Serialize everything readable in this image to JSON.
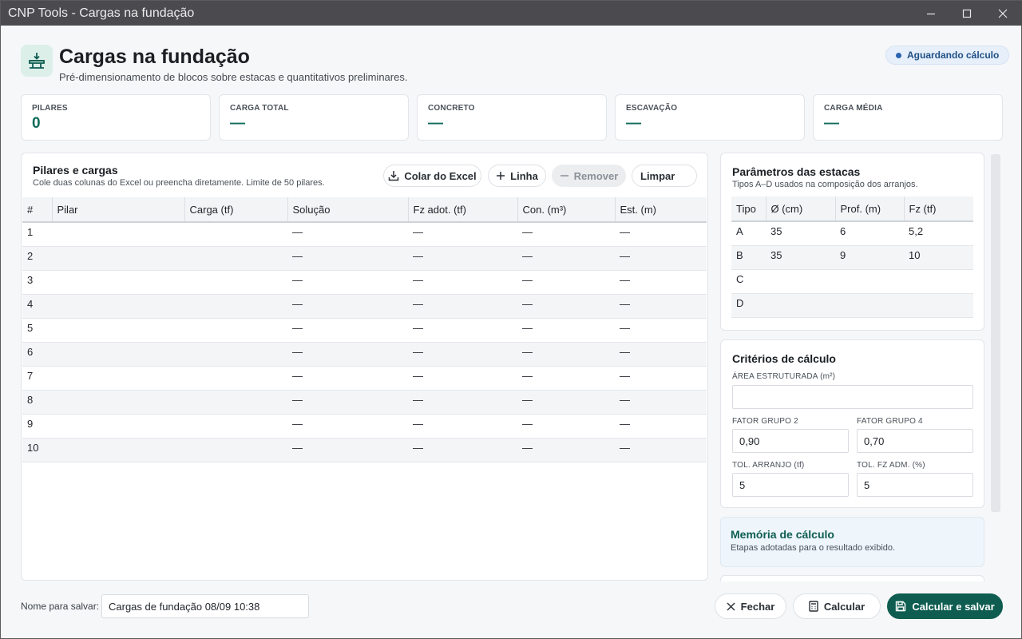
{
  "window": {
    "title": "CNP Tools - Cargas na fundação"
  },
  "header": {
    "title": "Cargas na fundação",
    "subtitle": "Pré-dimensionamento de blocos sobre estacas e quantitativos preliminares.",
    "status": "Aguardando cálculo"
  },
  "stats": [
    {
      "label": "PILARES",
      "value": "0"
    },
    {
      "label": "CARGA TOTAL",
      "value": "—"
    },
    {
      "label": "CONCRETO",
      "value": "—"
    },
    {
      "label": "ESCAVAÇÃO",
      "value": "—"
    },
    {
      "label": "CARGA MÉDIA",
      "value": "—"
    }
  ],
  "pillars": {
    "title": "Pilares e cargas",
    "subtitle": "Cole duas colunas do Excel ou preencha diretamente. Limite de 50 pilares.",
    "buttons": {
      "paste": "Colar do Excel",
      "add_row": "Linha",
      "remove": "Remover",
      "clear": "Limpar"
    },
    "columns": [
      "#",
      "Pilar",
      "Carga (tf)",
      "Solução",
      "Fz adot. (tf)",
      "Con. (m³)",
      "Est. (m)"
    ],
    "rows": [
      [
        "1",
        "",
        "",
        "—",
        "—",
        "—",
        "—"
      ],
      [
        "2",
        "",
        "",
        "—",
        "—",
        "—",
        "—"
      ],
      [
        "3",
        "",
        "",
        "—",
        "—",
        "—",
        "—"
      ],
      [
        "4",
        "",
        "",
        "—",
        "—",
        "—",
        "—"
      ],
      [
        "5",
        "",
        "",
        "—",
        "—",
        "—",
        "—"
      ],
      [
        "6",
        "",
        "",
        "—",
        "—",
        "—",
        "—"
      ],
      [
        "7",
        "",
        "",
        "—",
        "—",
        "—",
        "—"
      ],
      [
        "8",
        "",
        "",
        "—",
        "—",
        "—",
        "—"
      ],
      [
        "9",
        "",
        "",
        "—",
        "—",
        "—",
        "—"
      ],
      [
        "10",
        "",
        "",
        "—",
        "—",
        "—",
        "—"
      ]
    ]
  },
  "stakes": {
    "title": "Parâmetros das estacas",
    "subtitle": "Tipos A–D usados na composição dos arranjos.",
    "columns": [
      "Tipo",
      "Ø (cm)",
      "Prof. (m)",
      "Fz (tf)"
    ],
    "rows": [
      [
        "A",
        "35",
        "6",
        "5,2"
      ],
      [
        "B",
        "35",
        "9",
        "10"
      ],
      [
        "C",
        "",
        "",
        ""
      ],
      [
        "D",
        "",
        "",
        ""
      ]
    ]
  },
  "criteria": {
    "title": "Critérios de cálculo",
    "area_label": "ÁREA ESTRUTURADA (m²)",
    "area_value": "",
    "group2_label": "FATOR GRUPO 2",
    "group2_value": "0,90",
    "group4_label": "FATOR GRUPO 4",
    "group4_value": "0,70",
    "tol_arr_label": "TOL. ARRANJO (tf)",
    "tol_arr_value": "5",
    "tol_fz_label": "TOL. FZ ADM. (%)",
    "tol_fz_value": "5"
  },
  "memory": {
    "title": "Memória de cálculo",
    "subtitle": "Etapas adotadas para o resultado exibido."
  },
  "footer": {
    "save_name_label": "Nome para salvar:",
    "save_name_value": "Cargas de fundação 08/09 10:38",
    "close": "Fechar",
    "calculate": "Calcular",
    "calculate_save": "Calcular e salvar"
  },
  "colors": {
    "accent": "#0e5d50",
    "accent_value": "#0e6b5b",
    "status": "#1f4f86",
    "memory_bg": "#eef5fb"
  }
}
